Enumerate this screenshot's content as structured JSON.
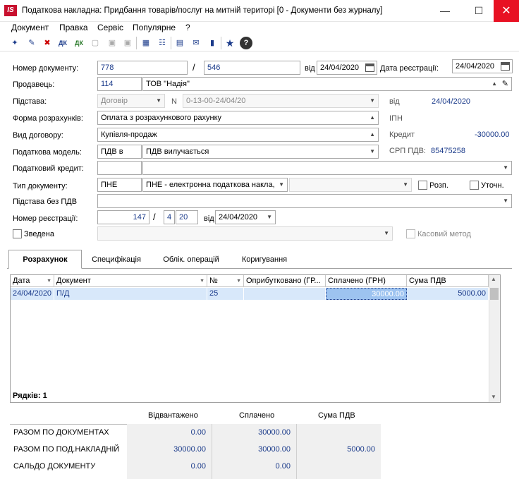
{
  "window": {
    "logo": "IS",
    "title": "Податкова накладна: Придбання товарів/послуг на митній територі [0 - Документи без журналу]"
  },
  "menu": [
    "Документ",
    "Правка",
    "Сервіс",
    "Популярне",
    "?"
  ],
  "form": {
    "doc_number_label": "Номер документу:",
    "doc_number": "778",
    "doc_number_sep": "/",
    "doc_number2": "546",
    "date_label": "від",
    "date": "24/04/2020",
    "reg_date_label": "Дата реєстрації:",
    "reg_date": "24/04/2020",
    "seller_label": "Продавець:",
    "seller_code": "114",
    "seller_name": "ТОВ \"Надія\"",
    "basis_label": "Підстава:",
    "basis_value": "Договір",
    "basis_n_label": "N",
    "basis_n": "0-13-00-24/04/20",
    "basis_date_label": "від",
    "basis_date": "24/04/2020",
    "payment_form_label": "Форма розрахунків:",
    "payment_form": "Оплата з розрахункового рахунку",
    "ipn_label": "ІПН",
    "contract_type_label": "Вид договору:",
    "contract_type": "Купівля-продаж",
    "credit_label": "Кредит",
    "credit_value": "-30000.00",
    "tax_model_label": "Податкова модель:",
    "tax_model_code": "ПДВ в",
    "tax_model": "ПДВ вилучається",
    "srp_label": "СРП ПДВ:",
    "srp_value": "85475258",
    "tax_credit_label": "Податковий кредит:",
    "doc_type_label": "Тип документу:",
    "doc_type_code": "ПНЕ",
    "doc_type": "ПНЕ - електронна податкова накла,",
    "rozp_label": "Розп.",
    "utoch_label": "Уточн.",
    "basis_no_vat_label": "Підстава без ПДВ",
    "reg_number_label": "Номер реєстрації:",
    "reg_number1": "147",
    "reg_sep": "/",
    "reg_number2": "4",
    "reg_number3": "20",
    "reg_date2_label": "від",
    "reg_date2": "24/04/2020",
    "summary_label": "Зведена",
    "cash_method_label": "Касовий метод"
  },
  "tabs": [
    "Розрахунок",
    "Специфікація",
    "Облік. операцій",
    "Коригування"
  ],
  "grid": {
    "columns": [
      "Дата",
      "Документ",
      "№",
      "Оприбутковано (ГР...",
      "Сплачено (ГРН)",
      "Сума ПДВ"
    ],
    "rows": [
      [
        "24/04/2020",
        "П/Д",
        "25",
        "",
        "30000.00",
        "5000.00"
      ]
    ],
    "rows_count": "Рядків: 1"
  },
  "totals": {
    "headers": [
      "Відвантажено",
      "Сплачено",
      "Сума ПДВ"
    ],
    "rows": [
      {
        "label": "РАЗОМ ПО ДОКУМЕНТАХ",
        "shipped": "0.00",
        "paid": "30000.00",
        "vat": ""
      },
      {
        "label": "РАЗОМ ПО ПОД.НАКЛАДНІЙ",
        "shipped": "30000.00",
        "paid": "30000.00",
        "vat": "5000.00"
      },
      {
        "label": "САЛЬДО ДОКУМЕНТУ",
        "shipped": "0.00",
        "paid": "0.00",
        "vat": ""
      }
    ]
  },
  "colors": {
    "accent": "#1a3a8a",
    "selection": "#9dc3f0",
    "close": "#e81123",
    "logo": "#c8102e"
  }
}
